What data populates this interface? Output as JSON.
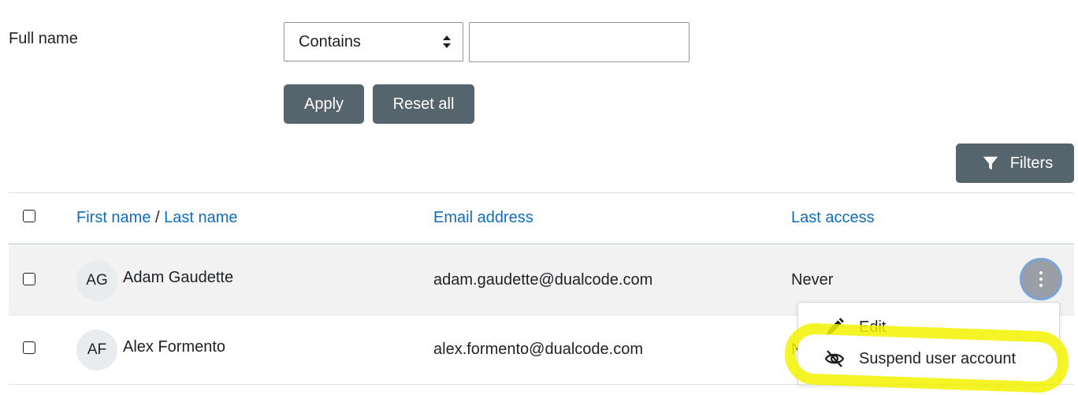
{
  "filter": {
    "label": "Full name",
    "operator": "Contains",
    "value": "",
    "apply_label": "Apply",
    "reset_label": "Reset all"
  },
  "toolbar": {
    "filters_label": "Filters",
    "filters_icon": "funnel-icon"
  },
  "table": {
    "headers": {
      "first_name": "First name",
      "separator": "/",
      "last_name": "Last name",
      "email": "Email address",
      "last_access": "Last access"
    },
    "rows": [
      {
        "initials": "AG",
        "name": "Adam Gaudette",
        "email": "adam.gaudette@dualcode.com",
        "last_access": "Never"
      },
      {
        "initials": "AF",
        "name": "Alex Formento",
        "email": "alex.formento@dualcode.com",
        "last_access": "N"
      }
    ]
  },
  "action_menu": {
    "items": [
      {
        "label": "Edit",
        "icon": "pencil-icon"
      },
      {
        "label": "Suspend user account",
        "icon": "eye-slash-icon"
      }
    ]
  },
  "colors": {
    "link": "#0f6cbf",
    "button": "#56656d",
    "highlight": "#f2f200"
  }
}
